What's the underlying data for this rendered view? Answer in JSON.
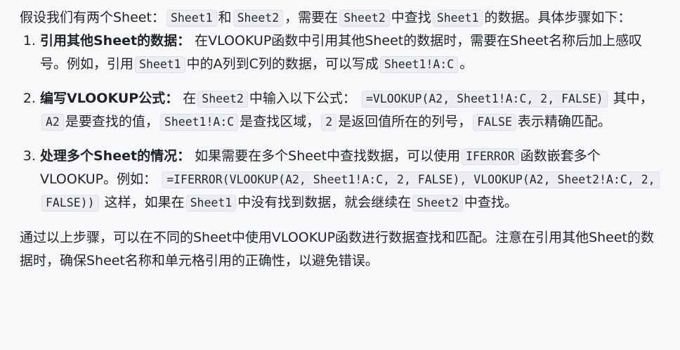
{
  "intro": {
    "part1": "假设我们有两个Sheet：",
    "code1": "Sheet1",
    "part2": "和",
    "code2": "Sheet2",
    "part3": "，需要在",
    "code3": "Sheet2",
    "part4": "中查找",
    "code4": "Sheet1",
    "part5": "的数据。具体步骤如下："
  },
  "steps": [
    {
      "title": "引用其他Sheet的数据",
      "colon": "：",
      "text1": "在VLOOKUP函数中引用其他Sheet的数据时，需要在Sheet名称后加上感叹号。例如，引用",
      "code1": "Sheet1",
      "text2": "中的A列到C列的数据，可以写成",
      "code2": "Sheet1!A:C",
      "text3": "。"
    },
    {
      "title": "编写VLOOKUP公式",
      "colon": "：",
      "text1": "在",
      "code1": "Sheet2",
      "text2": "中输入以下公式：",
      "code2": "=VLOOKUP(A2, Sheet1!A:C, 2, FALSE)",
      "text3": "其中，",
      "code3": "A2",
      "text4": "是要查找的值，",
      "code4": "Sheet1!A:C",
      "text5": "是查找区域，",
      "code5": "2",
      "text6": "是返回值所在的列号，",
      "code6": "FALSE",
      "text7": "表示精确匹配。"
    },
    {
      "title": "处理多个Sheet的情况",
      "colon": "：",
      "text1": "如果需要在多个Sheet中查找数据，可以使用",
      "code1": "IFERROR",
      "text2": "函数嵌套多个VLOOKUP。例如：",
      "code2": "=IFERROR(VLOOKUP(A2, Sheet1!A:C, 2, FALSE), VLOOKUP(A2, Sheet2!A:C, 2, FALSE))",
      "text3": "这样，如果在",
      "code3": "Sheet1",
      "text4": "中没有找到数据，就会继续在",
      "code4": "Sheet2",
      "text5": "中查找。"
    }
  ],
  "outro": "通过以上步骤，可以在不同的Sheet中使用VLOOKUP函数进行数据查找和匹配。注意在引用其他Sheet的数据时，确保Sheet名称和单元格引用的正确性，以避免错误。"
}
